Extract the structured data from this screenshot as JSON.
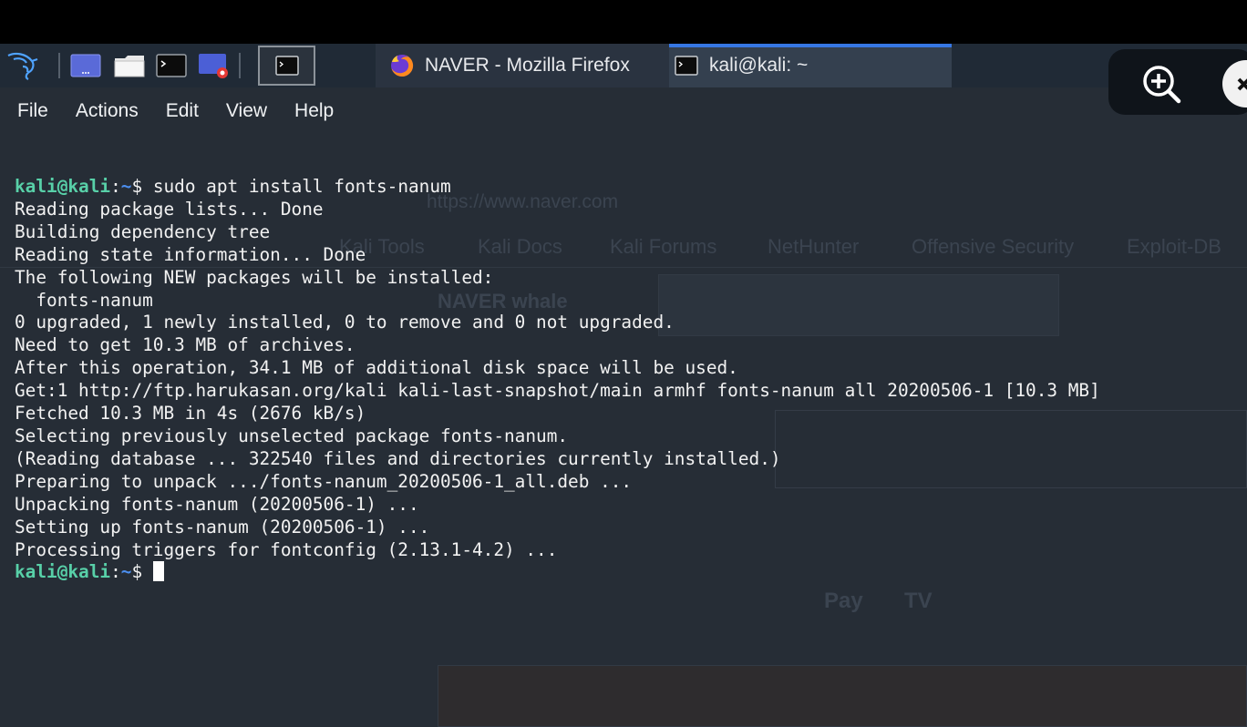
{
  "taskbar": {
    "tasks": [
      {
        "label": "NAVER - Mozilla Firefox",
        "icon": "firefox-icon"
      },
      {
        "label": "kali@kali: ~",
        "icon": "terminal-icon"
      }
    ],
    "accent": "#3677e4"
  },
  "menubar": {
    "items": [
      "File",
      "Actions",
      "Edit",
      "View",
      "Help"
    ]
  },
  "terminal": {
    "prompt_user": "kali@kali",
    "prompt_sep": ":",
    "prompt_path": "~",
    "prompt_symbol": "$",
    "command": " sudo apt install fonts-nanum",
    "output": [
      "Reading package lists... Done",
      "Building dependency tree",
      "Reading state information... Done",
      "The following NEW packages will be installed:",
      "  fonts-nanum",
      "0 upgraded, 1 newly installed, 0 to remove and 0 not upgraded.",
      "Need to get 10.3 MB of archives.",
      "After this operation, 34.1 MB of additional disk space will be used.",
      "Get:1 http://ftp.harukasan.org/kali kali-last-snapshot/main armhf fonts-nanum all 20200506-1 [10.3 MB]",
      "Fetched 10.3 MB in 4s (2676 kB/s)",
      "Selecting previously unselected package fonts-nanum.",
      "(Reading database ... 322540 files and directories currently installed.)",
      "Preparing to unpack .../fonts-nanum_20200506-1_all.deb ...",
      "Unpacking fonts-nanum (20200506-1) ...",
      "Setting up fonts-nanum (20200506-1) ...",
      "Processing triggers for fontconfig (2.13.1-4.2) ..."
    ],
    "colors": {
      "user": "#58d0a8",
      "path": "#4c8ff0",
      "text": "#f2f2f2",
      "bg": "#262d36"
    }
  },
  "background_window": {
    "url": "https://www.naver.com",
    "bookmarks": [
      "Kali Tools",
      "Kali Docs",
      "Kali Forums",
      "NetHunter",
      "Offensive Security",
      "Exploit-DB"
    ],
    "naver_whale": "NAVER whale",
    "pay": "Pay",
    "tv": "TV"
  }
}
